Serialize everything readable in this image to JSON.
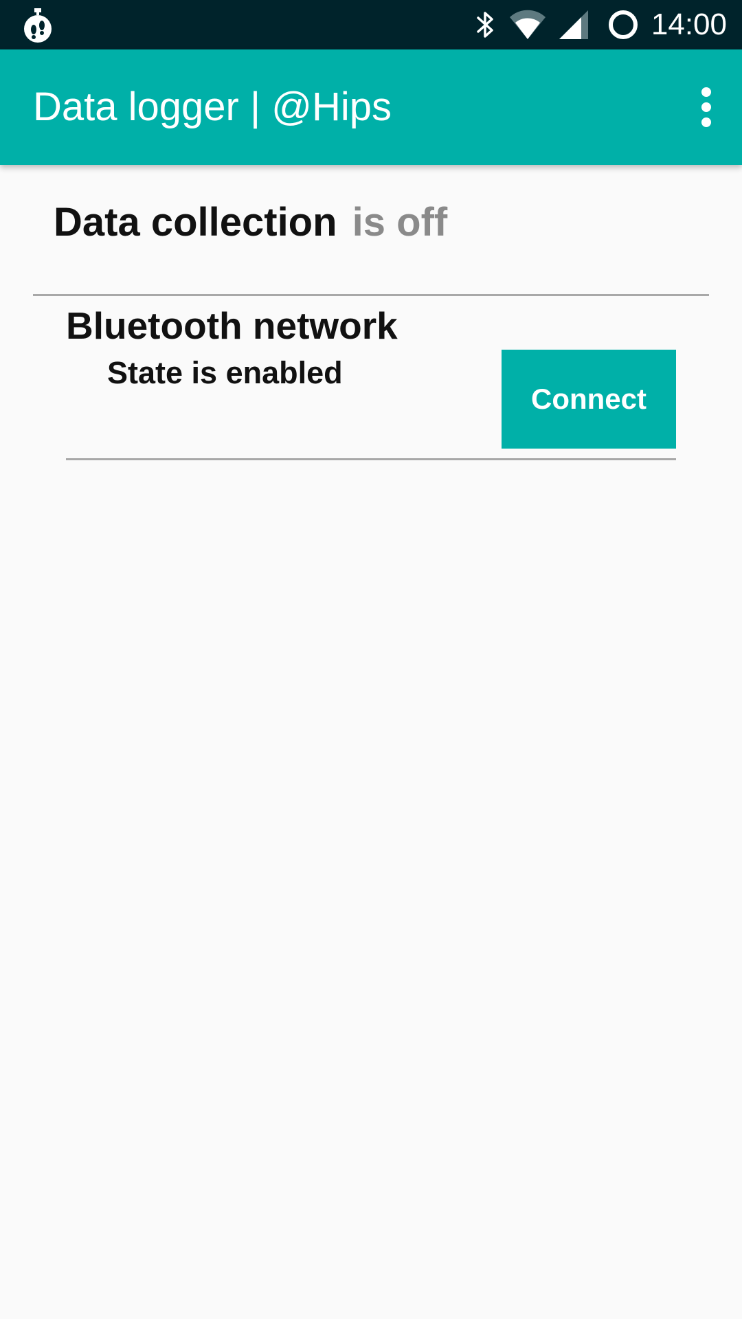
{
  "status_bar": {
    "time": "14:00",
    "icons": [
      "stopwatch-footsteps-icon",
      "bluetooth-icon",
      "wifi-icon",
      "cell-signal-icon",
      "sync-ring-icon"
    ]
  },
  "app_bar": {
    "title": "Data logger | @Hips",
    "menu_icon": "overflow-menu-icon"
  },
  "data_collection": {
    "label": "Data collection",
    "state": "is off"
  },
  "bluetooth": {
    "title": "Bluetooth network",
    "state_text": "State is enabled",
    "connect_label": "Connect"
  },
  "colors": {
    "status_bar": "#00232b",
    "app_bar": "#00b0a8",
    "accent": "#00b0a8",
    "background": "#fafafa",
    "muted_text": "#8a8a8a",
    "divider": "#a8a8a8"
  }
}
